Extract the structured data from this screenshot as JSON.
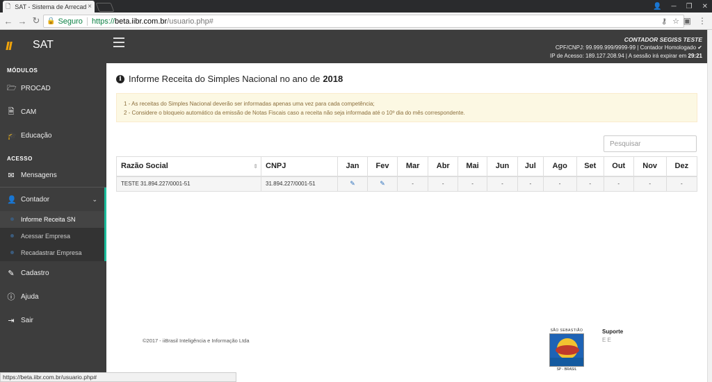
{
  "browser": {
    "tab_title": "SAT - Sistema de Arrecad",
    "tab_close": "×",
    "win_min": "─",
    "win_max": "❐",
    "win_close": "✕",
    "secure_label": "Seguro",
    "url_scheme": "https://",
    "url_host": "beta.iibr.com.br",
    "url_path": "/usuario.php#",
    "status_url": "https://beta.iibr.com.br/usuario.php#"
  },
  "app": {
    "brand_name": "SAT",
    "user_name": "CONTADOR SEGISS TESTE",
    "user_line2": "CPF/CNPJ: 99.999.999/9999-99 | Contador Homologado ✔",
    "user_line3_prefix": "IP de Acesso: 189.127.208.94 | A sessão irá expirar em ",
    "session_time": "29:21"
  },
  "sidebar": {
    "section_modulos": "MÓDULOS",
    "section_acesso": "ACESSO",
    "modulos": [
      {
        "label": "PROCAD",
        "icon": "folder-open-icon"
      },
      {
        "label": "CAM",
        "icon": "file-pdf-icon"
      },
      {
        "label": "Educação",
        "icon": "graduation-cap-icon"
      }
    ],
    "acesso": [
      {
        "label": "Mensagens",
        "icon": "envelope-icon"
      },
      {
        "label": "Contador",
        "icon": "user-icon"
      },
      {
        "label": "Cadastro",
        "icon": "edit-icon"
      },
      {
        "label": "Ajuda",
        "icon": "info-circle-icon"
      },
      {
        "label": "Sair",
        "icon": "sign-out-icon"
      }
    ],
    "submenu": [
      "Informe Receita SN",
      "Acessar Empresa",
      "Recadastrar Empresa"
    ]
  },
  "main": {
    "title_prefix": "Informe Receita do Simples Nacional no ano de",
    "title_year": "2018",
    "alert_line1": "1 - As receitas do Simples Nacional deverão ser informadas apenas uma vez para cada competência;",
    "alert_line2": "2 - Considere o bloqueio automático da emissão de Notas Fiscais caso a receita não seja informada até o 10º dia do mês correspondente.",
    "search_placeholder": "Pesquisar",
    "table": {
      "headers": [
        "Razão Social",
        "CNPJ",
        "Jan",
        "Fev",
        "Mar",
        "Abr",
        "Mai",
        "Jun",
        "Jul",
        "Ago",
        "Set",
        "Out",
        "Nov",
        "Dez"
      ],
      "row": {
        "razao_social": "TESTE 31.894.227/0001-51",
        "cnpj": "31.894.227/0001-51",
        "months": [
          "✎",
          "✎",
          "-",
          "-",
          "-",
          "-",
          "-",
          "-",
          "-",
          "-",
          "-",
          "-"
        ]
      }
    }
  },
  "footer": {
    "copyright": "©2017 - iiBrasil Inteligência e Informação Ltda",
    "seal_top": "SÃO SEBASTIÃO",
    "seal_bottom": "SP - BRASIL",
    "support_title": "Suporte",
    "support_links": "E E"
  }
}
